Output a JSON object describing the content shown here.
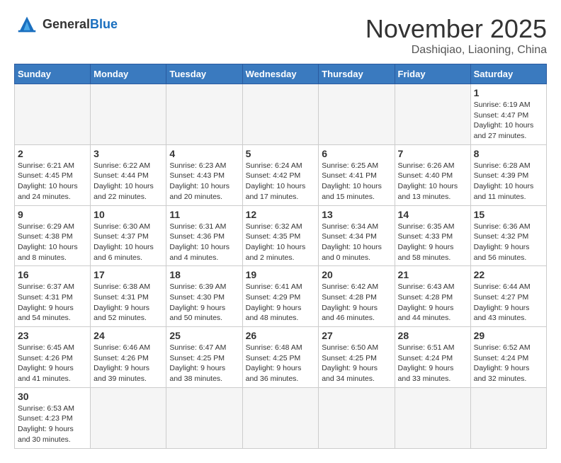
{
  "header": {
    "logo_general": "General",
    "logo_blue": "Blue",
    "month": "November 2025",
    "location": "Dashiqiao, Liaoning, China"
  },
  "weekdays": [
    "Sunday",
    "Monday",
    "Tuesday",
    "Wednesday",
    "Thursday",
    "Friday",
    "Saturday"
  ],
  "days": {
    "1": {
      "sunrise": "6:19 AM",
      "sunset": "4:47 PM",
      "daylight": "10 hours and 27 minutes."
    },
    "2": {
      "sunrise": "6:21 AM",
      "sunset": "4:45 PM",
      "daylight": "10 hours and 24 minutes."
    },
    "3": {
      "sunrise": "6:22 AM",
      "sunset": "4:44 PM",
      "daylight": "10 hours and 22 minutes."
    },
    "4": {
      "sunrise": "6:23 AM",
      "sunset": "4:43 PM",
      "daylight": "10 hours and 20 minutes."
    },
    "5": {
      "sunrise": "6:24 AM",
      "sunset": "4:42 PM",
      "daylight": "10 hours and 17 minutes."
    },
    "6": {
      "sunrise": "6:25 AM",
      "sunset": "4:41 PM",
      "daylight": "10 hours and 15 minutes."
    },
    "7": {
      "sunrise": "6:26 AM",
      "sunset": "4:40 PM",
      "daylight": "10 hours and 13 minutes."
    },
    "8": {
      "sunrise": "6:28 AM",
      "sunset": "4:39 PM",
      "daylight": "10 hours and 11 minutes."
    },
    "9": {
      "sunrise": "6:29 AM",
      "sunset": "4:38 PM",
      "daylight": "10 hours and 8 minutes."
    },
    "10": {
      "sunrise": "6:30 AM",
      "sunset": "4:37 PM",
      "daylight": "10 hours and 6 minutes."
    },
    "11": {
      "sunrise": "6:31 AM",
      "sunset": "4:36 PM",
      "daylight": "10 hours and 4 minutes."
    },
    "12": {
      "sunrise": "6:32 AM",
      "sunset": "4:35 PM",
      "daylight": "10 hours and 2 minutes."
    },
    "13": {
      "sunrise": "6:34 AM",
      "sunset": "4:34 PM",
      "daylight": "10 hours and 0 minutes."
    },
    "14": {
      "sunrise": "6:35 AM",
      "sunset": "4:33 PM",
      "daylight": "9 hours and 58 minutes."
    },
    "15": {
      "sunrise": "6:36 AM",
      "sunset": "4:32 PM",
      "daylight": "9 hours and 56 minutes."
    },
    "16": {
      "sunrise": "6:37 AM",
      "sunset": "4:31 PM",
      "daylight": "9 hours and 54 minutes."
    },
    "17": {
      "sunrise": "6:38 AM",
      "sunset": "4:31 PM",
      "daylight": "9 hours and 52 minutes."
    },
    "18": {
      "sunrise": "6:39 AM",
      "sunset": "4:30 PM",
      "daylight": "9 hours and 50 minutes."
    },
    "19": {
      "sunrise": "6:41 AM",
      "sunset": "4:29 PM",
      "daylight": "9 hours and 48 minutes."
    },
    "20": {
      "sunrise": "6:42 AM",
      "sunset": "4:28 PM",
      "daylight": "9 hours and 46 minutes."
    },
    "21": {
      "sunrise": "6:43 AM",
      "sunset": "4:28 PM",
      "daylight": "9 hours and 44 minutes."
    },
    "22": {
      "sunrise": "6:44 AM",
      "sunset": "4:27 PM",
      "daylight": "9 hours and 43 minutes."
    },
    "23": {
      "sunrise": "6:45 AM",
      "sunset": "4:26 PM",
      "daylight": "9 hours and 41 minutes."
    },
    "24": {
      "sunrise": "6:46 AM",
      "sunset": "4:26 PM",
      "daylight": "9 hours and 39 minutes."
    },
    "25": {
      "sunrise": "6:47 AM",
      "sunset": "4:25 PM",
      "daylight": "9 hours and 38 minutes."
    },
    "26": {
      "sunrise": "6:48 AM",
      "sunset": "4:25 PM",
      "daylight": "9 hours and 36 minutes."
    },
    "27": {
      "sunrise": "6:50 AM",
      "sunset": "4:25 PM",
      "daylight": "9 hours and 34 minutes."
    },
    "28": {
      "sunrise": "6:51 AM",
      "sunset": "4:24 PM",
      "daylight": "9 hours and 33 minutes."
    },
    "29": {
      "sunrise": "6:52 AM",
      "sunset": "4:24 PM",
      "daylight": "9 hours and 32 minutes."
    },
    "30": {
      "sunrise": "6:53 AM",
      "sunset": "4:23 PM",
      "daylight": "9 hours and 30 minutes."
    }
  }
}
